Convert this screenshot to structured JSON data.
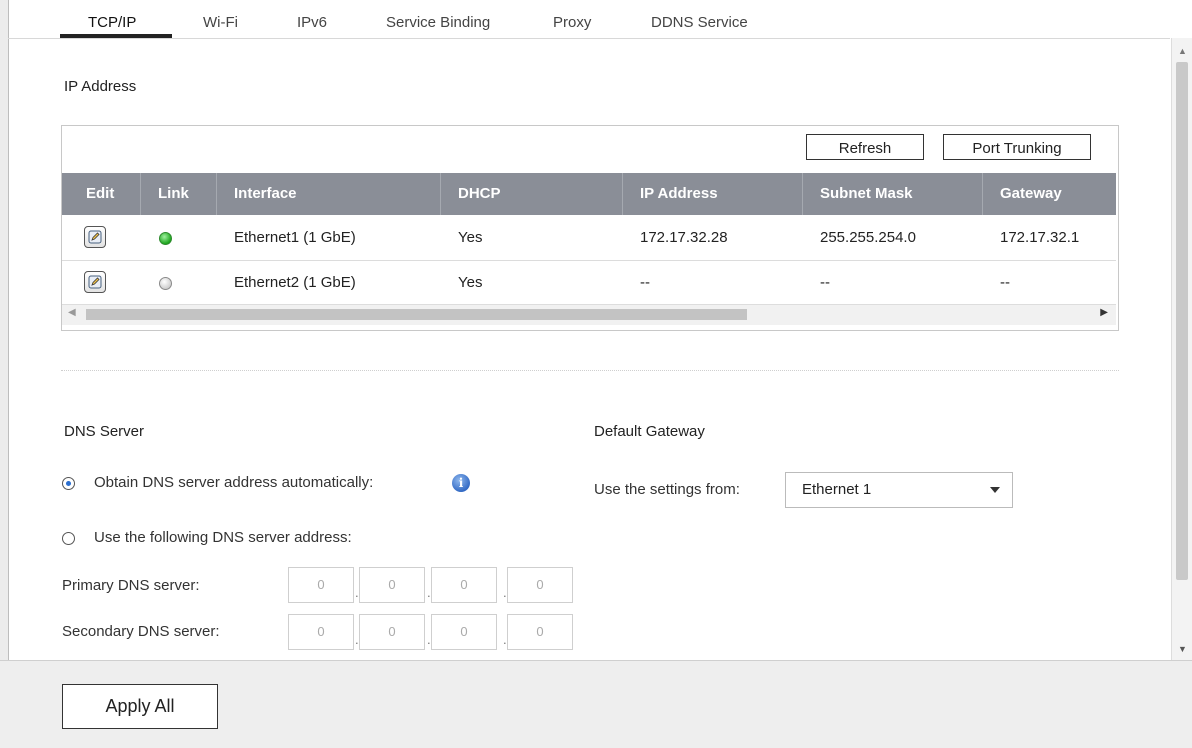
{
  "tabs": [
    {
      "label": "TCP/IP",
      "active": true
    },
    {
      "label": "Wi-Fi"
    },
    {
      "label": "IPv6"
    },
    {
      "label": "Service Binding"
    },
    {
      "label": "Proxy"
    },
    {
      "label": "DDNS Service"
    }
  ],
  "ip_section": {
    "title": "IP Address",
    "refresh_label": "Refresh",
    "port_trunking_label": "Port Trunking",
    "columns": [
      "Edit",
      "Link",
      "Interface",
      "DHCP",
      "IP Address",
      "Subnet Mask",
      "Gateway"
    ],
    "rows": [
      {
        "link": "green",
        "interface": "Ethernet1 (1 GbE)",
        "dhcp": "Yes",
        "ip": "172.17.32.28",
        "mask": "255.255.254.0",
        "gateway": "172.17.32.1"
      },
      {
        "link": "grey",
        "interface": "Ethernet2 (1 GbE)",
        "dhcp": "Yes",
        "ip": "--",
        "mask": "--",
        "gateway": "--"
      }
    ]
  },
  "dns": {
    "title": "DNS Server",
    "auto_label": "Obtain DNS server address automatically:",
    "manual_label": "Use the following DNS server address:",
    "primary_label": "Primary DNS server:",
    "secondary_label": "Secondary DNS server:",
    "primary": [
      "0",
      "0",
      "0",
      "0"
    ],
    "secondary": [
      "0",
      "0",
      "0",
      "0"
    ],
    "selected": "auto"
  },
  "gateway": {
    "title": "Default Gateway",
    "use_label": "Use the settings from:",
    "selected": "Ethernet 1"
  },
  "footer": {
    "apply_label": "Apply All"
  },
  "icons": [
    "edit-icon",
    "status-led-icon",
    "info-icon",
    "chevron-down-icon"
  ],
  "colors": {
    "header_bg": "#8a8e97",
    "link_up": "#1ea51e",
    "link_down": "#cfcfcf",
    "info": "#2e66c2"
  }
}
